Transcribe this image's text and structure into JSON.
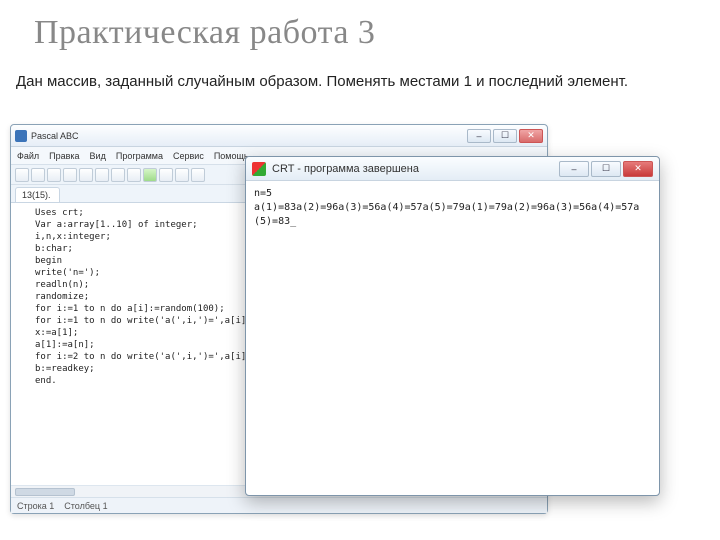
{
  "slide": {
    "title": "Практическая работа 3",
    "task": "Дан массив, заданный случайным образом. Поменять местами 1 и последний элемент."
  },
  "ide": {
    "window_title": "Pascal ABC",
    "menu": [
      "Файл",
      "Правка",
      "Вид",
      "Программа",
      "Сервис",
      "Помощь"
    ],
    "tab": "13(15).",
    "code": "Uses crt;\nVar a:array[1..10] of integer;\ni,n,x:integer;\nb:char;\nbegin\nwrite('n=');\nreadln(n);\nrandomize;\nfor i:=1 to n do a[i]:=random(100);\nfor i:=1 to n do write('a(',i,')=',a[i]);\nx:=a[1];\na[1]:=a[n];\nfor i:=2 to n do write('a(',i,')=',a[i]);\nb:=readkey;\nend.",
    "status_left": "Строка 1",
    "status_right": "Столбец 1"
  },
  "crt": {
    "window_title": "CRT - программа завершена",
    "output": "n=5\na(1)=83a(2)=96a(3)=56a(4)=57a(5)=79a(1)=79a(2)=96a(3)=56a(4)=57a(5)=83_"
  },
  "icons": {
    "min": "–",
    "max": "☐",
    "close": "✕"
  }
}
